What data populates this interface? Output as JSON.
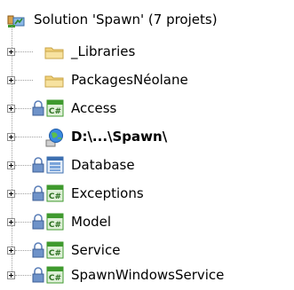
{
  "tree": {
    "root": {
      "label": "Solution 'Spawn' (7 projets)",
      "icon": "solution-icon"
    },
    "items": [
      {
        "label": "_Libraries",
        "icon": "folder-icon",
        "bold": false
      },
      {
        "label": "PackagesNéolane",
        "icon": "folder-icon",
        "bold": false
      },
      {
        "label": "Access",
        "icon": "csharp-project-locked-icon",
        "bold": false
      },
      {
        "label": "D:\\...\\Spawn\\",
        "icon": "website-globe-icon",
        "bold": true
      },
      {
        "label": "Database",
        "icon": "database-project-locked-icon",
        "bold": false
      },
      {
        "label": "Exceptions",
        "icon": "csharp-project-locked-icon",
        "bold": false
      },
      {
        "label": "Model",
        "icon": "csharp-project-locked-icon",
        "bold": false
      },
      {
        "label": "Service",
        "icon": "csharp-project-locked-icon",
        "bold": false
      },
      {
        "label": "SpawnWindowsService",
        "icon": "csharp-project-locked-icon",
        "bold": false
      }
    ]
  },
  "colors": {
    "folder": "#f2d27a",
    "csharp_green": "#3f9a2e",
    "lock_blue": "#5b7fb8",
    "globe_blue": "#2f7bd6"
  }
}
